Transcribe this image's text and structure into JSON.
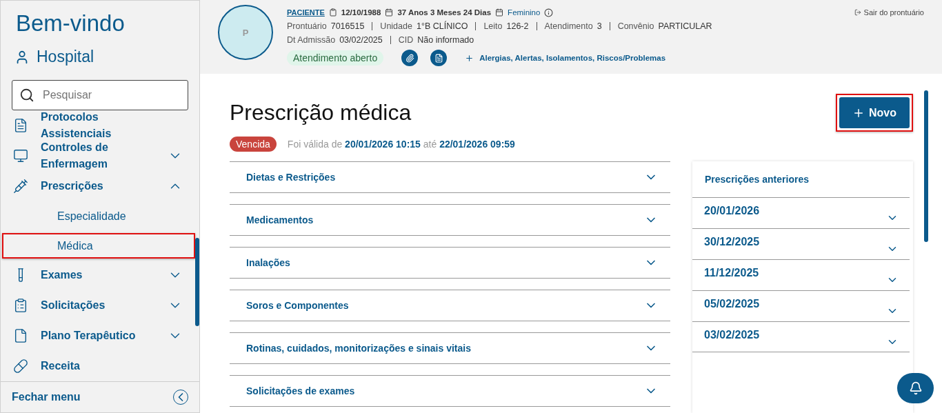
{
  "sidebar": {
    "greeting": "Bem-vindo",
    "hospital": "Hospital",
    "search": {
      "placeholder": "Pesquisar"
    },
    "items": [
      {
        "label": "Protocolos Assistenciais"
      },
      {
        "label": "Controles de Enfermagem",
        "expanded": false
      },
      {
        "label": "Prescrições",
        "expanded": true,
        "children": [
          {
            "label": "Especialidade",
            "selected": false,
            "highlighted": false
          },
          {
            "label": "Médica",
            "selected": true,
            "highlighted": true
          }
        ]
      },
      {
        "label": "Exames",
        "expanded": false
      },
      {
        "label": "Solicitações",
        "expanded": false
      },
      {
        "label": "Plano Terapêutico",
        "expanded": false
      },
      {
        "label": "Receita"
      }
    ],
    "footer": "Fechar menu"
  },
  "patient": {
    "initial": "P",
    "name": "PACIENTE",
    "birth_date": "12/10/1988",
    "age": "37 Anos 3 Meses 24 Dias",
    "sex": "Feminino",
    "details": [
      {
        "label": "Prontuário",
        "value": "7016515"
      },
      {
        "label": "Unidade",
        "value": "1°B CLÍNICO"
      },
      {
        "label": "Leito",
        "value": "126-2"
      },
      {
        "label": "Atendimento",
        "value": "3"
      },
      {
        "label": "Convênio",
        "value": "PARTICULAR"
      }
    ],
    "admission": [
      {
        "label": "Dt Admissão",
        "value": "03/02/2025"
      },
      {
        "label": "CID",
        "value": "Não informado"
      }
    ],
    "status": "Atendimento aberto",
    "alerts_link": "Alergias, Alertas, Isolamentos, Riscos/Problemas",
    "exit": "Sair do prontuário"
  },
  "page": {
    "title": "Prescrição médica",
    "new_button": {
      "label": "Novo",
      "highlighted": true
    },
    "status": "Vencida",
    "validity": "Foi válida de **20/01/2026 10:15** até **22/01/2026 09:59**",
    "sections": [
      {
        "label": "Dietas e Restrições",
        "expanded": false
      },
      {
        "label": "Medicamentos",
        "expanded": false
      },
      {
        "label": "Inalações",
        "expanded": false
      },
      {
        "label": "Soros e Componentes",
        "expanded": false
      },
      {
        "label": "Rotinas, cuidados, monitorizações e sinais vitais",
        "expanded": false
      },
      {
        "label": "Solicitações de exames",
        "expanded": false
      }
    ],
    "previous": {
      "title": "Prescrições anteriores",
      "items": [
        {
          "label": "20/01/2026",
          "expanded": false
        },
        {
          "label": "30/12/2025",
          "expanded": false
        },
        {
          "label": "11/12/2025",
          "expanded": false
        },
        {
          "label": "05/02/2025",
          "expanded": false
        },
        {
          "label": "03/02/2025",
          "expanded": false
        }
      ]
    }
  }
}
